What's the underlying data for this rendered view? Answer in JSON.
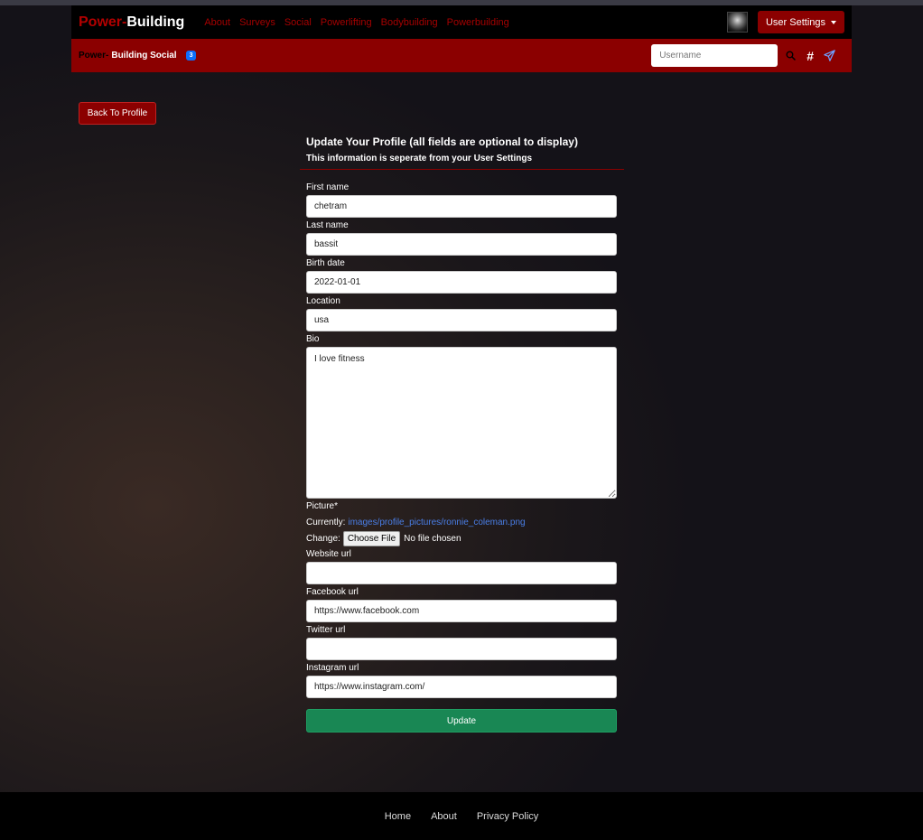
{
  "navbar": {
    "brand_part1": "Power-",
    "brand_part2": "Building",
    "links": [
      "About",
      "Surveys",
      "Social",
      "Powerlifting",
      "Bodybuilding",
      "Powerbuilding"
    ],
    "user_settings_label": "User Settings",
    "brand_color": "#8b0000"
  },
  "subbar": {
    "brand_part1": "Power-",
    "brand_part2": "Building Social",
    "badge_count": "3",
    "search_placeholder": "Username",
    "hash_label": "#"
  },
  "back_button_label": "Back To Profile",
  "form": {
    "title": "Update Your Profile (all fields are optional to display)",
    "subtitle": "This information is seperate from your User Settings",
    "first_name": {
      "label": "First name",
      "value": "chetram"
    },
    "last_name": {
      "label": "Last name",
      "value": "bassit"
    },
    "birth_date": {
      "label": "Birth date",
      "value": "2022-01-01"
    },
    "location": {
      "label": "Location",
      "value": "usa"
    },
    "bio": {
      "label": "Bio",
      "value": "I love fitness"
    },
    "picture": {
      "label": "Picture*",
      "currently_label": "Currently:",
      "current_path": "images/profile_pictures/ronnie_coleman.png",
      "change_label": "Change:",
      "choose_label": "Choose File",
      "no_file_label": "No file chosen"
    },
    "website_url": {
      "label": "Website url",
      "value": ""
    },
    "facebook_url": {
      "label": "Facebook url",
      "value": "https://www.facebook.com"
    },
    "twitter_url": {
      "label": "Twitter url",
      "value": ""
    },
    "instagram_url": {
      "label": "Instagram url",
      "value": "https://www.instagram.com/"
    },
    "update_label": "Update",
    "update_color": "#198754"
  },
  "footer": {
    "links": [
      "Home",
      "About",
      "Privacy Policy"
    ]
  },
  "icons": {
    "search": "search-icon",
    "send": "send-icon"
  }
}
